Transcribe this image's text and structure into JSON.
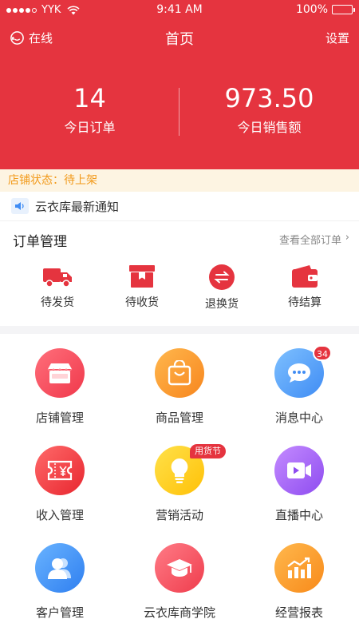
{
  "status_bar": {
    "carrier": "YYK",
    "time": "9:41 AM",
    "battery": "100%"
  },
  "nav": {
    "online_label": "在线",
    "title": "首页",
    "settings_label": "设置"
  },
  "stats": [
    {
      "value": "14",
      "label": "今日订单"
    },
    {
      "value": "973.50",
      "label": "今日销售额"
    }
  ],
  "shop_status": "店铺状态：待上架",
  "notice": "云衣库最新通知",
  "orders": {
    "title": "订单管理",
    "view_all": "查看全部订单",
    "items": [
      {
        "label": "待发货",
        "icon": "truck-icon"
      },
      {
        "label": "待收货",
        "icon": "box-icon"
      },
      {
        "label": "退换货",
        "icon": "exchange-icon"
      },
      {
        "label": "待结算",
        "icon": "wallet-icon"
      }
    ]
  },
  "grid": [
    {
      "label": "店铺管理",
      "icon": "shop-icon",
      "color_from": "#ff6f7b",
      "color_to": "#f0384b"
    },
    {
      "label": "商品管理",
      "icon": "bag-icon",
      "color_from": "#ffb74d",
      "color_to": "#f7861e"
    },
    {
      "label": "消息中心",
      "icon": "chat-icon",
      "color_from": "#7ec0ff",
      "color_to": "#3f8cf4",
      "badge": "34"
    },
    {
      "label": "收入管理",
      "icon": "ticket-icon",
      "color_from": "#ff6a6a",
      "color_to": "#e8262f"
    },
    {
      "label": "营销活动",
      "icon": "bulb-icon",
      "color_from": "#ffe14a",
      "color_to": "#ffc107",
      "tag": "用货节"
    },
    {
      "label": "直播中心",
      "icon": "video-icon",
      "color_from": "#c48bff",
      "color_to": "#8e4cf0"
    },
    {
      "label": "客户管理",
      "icon": "contacts-icon",
      "color_from": "#69b3ff",
      "color_to": "#2f7ff0"
    },
    {
      "label": "云衣库商学院",
      "icon": "graduation-cap-icon",
      "color_from": "#ff7b86",
      "color_to": "#ef3d4d"
    },
    {
      "label": "经营报表",
      "icon": "chart-icon",
      "color_from": "#ffb84d",
      "color_to": "#f88a1a"
    }
  ],
  "colors": {
    "primary": "#e5343f",
    "status_text": "#f29a1b",
    "status_bg": "#fdf4e2"
  }
}
